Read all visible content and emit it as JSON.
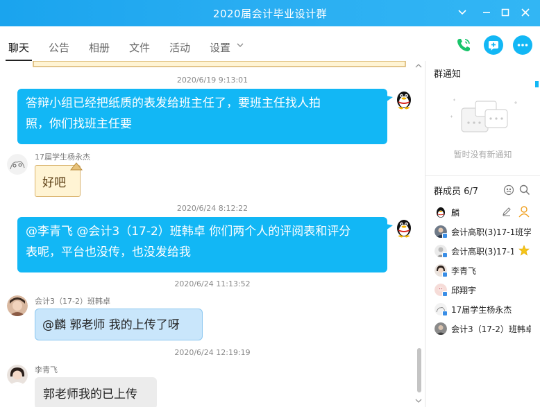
{
  "window": {
    "title": "2020届会计毕业设计群"
  },
  "tabs": [
    {
      "label": "聊天"
    },
    {
      "label": "公告"
    },
    {
      "label": "相册"
    },
    {
      "label": "文件"
    },
    {
      "label": "活动"
    },
    {
      "label": "设置"
    }
  ],
  "messages": [
    {
      "timestamp": "2020/6/19 9:13:01",
      "text_line1": "答辩小组已经把纸质的表发给班主任了，要班主任找人拍",
      "text_line2": "照，你们找班主任要"
    },
    {
      "sender": "17届学生杨永杰",
      "text": "好吧"
    },
    {
      "timestamp": "2020/6/24 8:12:22",
      "text_line1": "@李青飞  @会计3（17-2）班韩卓  你们两个人的评阅表和评分",
      "text_line2": "表呢，平台也没传，也没发给我"
    },
    {
      "timestamp": "2020/6/24 11:13:52",
      "sender": "会计3（17-2）班韩卓",
      "text": "@麟  郭老师   我的上传了呀"
    },
    {
      "timestamp": "2020/6/24 12:19:19",
      "sender": "李青飞",
      "text": "郭老师我的已上传"
    }
  ],
  "panel": {
    "notice_title": "群通知",
    "notice_empty": "暂时没有新通知",
    "members_title": "群成员 6/7",
    "members": [
      {
        "name": "麟"
      },
      {
        "name": "会计高职(3)17-1班学"
      },
      {
        "name": "会计高职(3)17-1"
      },
      {
        "name": "李青飞"
      },
      {
        "name": "邱翔宇"
      },
      {
        "name": "17届学生杨永杰"
      },
      {
        "name": "会计3（17-2）班韩卓"
      }
    ]
  },
  "colors": {
    "accent": "#12b7f5",
    "titlebar": "#1aa4ee",
    "call": "#19c46a"
  }
}
